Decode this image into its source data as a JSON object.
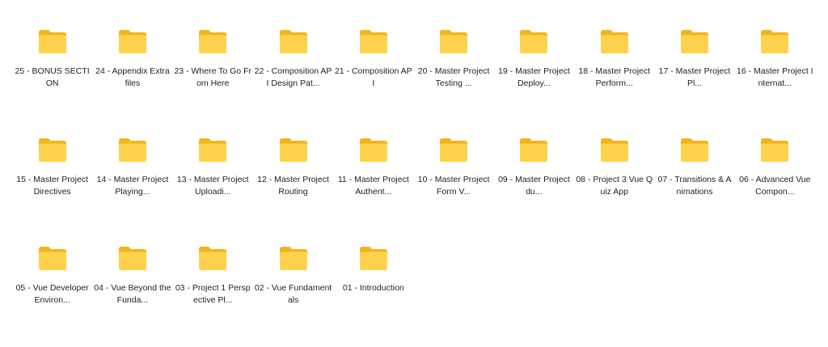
{
  "folder_icon": "folder-icon",
  "colors": {
    "folder_back": "#f2b51d",
    "folder_front": "#ffd24d",
    "background": "#ffffff"
  },
  "folders": [
    {
      "label": "25 - BONUS SECTION"
    },
    {
      "label": "24 - Appendix Extra files"
    },
    {
      "label": "23 - Where To Go From Here"
    },
    {
      "label": "22 - Composition API Design Pat..."
    },
    {
      "label": "21 - Composition API"
    },
    {
      "label": "20 - Master Project Testing ..."
    },
    {
      "label": "19 - Master Project Deploy..."
    },
    {
      "label": "18 - Master Project Perform..."
    },
    {
      "label": "17 - Master Project Pl..."
    },
    {
      "label": "16 - Master Project Internat..."
    },
    {
      "label": "15 - Master Project Directives"
    },
    {
      "label": "14 - Master Project Playing..."
    },
    {
      "label": "13 - Master Project Uploadi..."
    },
    {
      "label": "12 - Master Project Routing"
    },
    {
      "label": "11 - Master Project Authent..."
    },
    {
      "label": "10 - Master Project Form V..."
    },
    {
      "label": "09 - Master Project du..."
    },
    {
      "label": "08 - Project 3 Vue Quiz App"
    },
    {
      "label": "07 - Transitions & Animations"
    },
    {
      "label": "06 - Advanced Vue Compon..."
    },
    {
      "label": "05 - Vue Developer Environ..."
    },
    {
      "label": "04 - Vue Beyond the Funda..."
    },
    {
      "label": "03 - Project 1 Perspective Pl..."
    },
    {
      "label": "02 - Vue Fundamentals"
    },
    {
      "label": "01 - Introduction"
    }
  ]
}
